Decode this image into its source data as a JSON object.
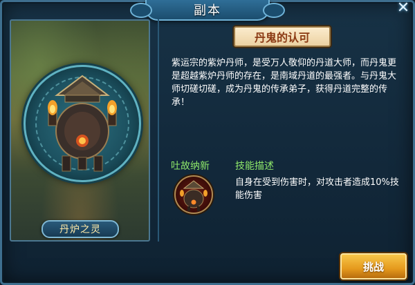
{
  "window": {
    "title": "副本"
  },
  "portrait": {
    "name": "丹炉之灵"
  },
  "info": {
    "skill_title": "丹鬼的认可",
    "description": "紫运宗的紫炉丹师，是受万人敬仰的丹道大师，而丹鬼更是超越紫炉丹师的存在，是南域丹道的最强者。与丹鬼大师切磋切磋，成为丹鬼的传承弟子，获得丹道完整的传承！",
    "skill_name_label": "吐故纳新",
    "skill_desc_label": "技能描述",
    "skill_desc": "自身在受到伤害时，对攻击者造成10%技能伤害"
  },
  "actions": {
    "challenge_label": "挑战"
  },
  "icons": {
    "close": "close-icon",
    "furnace": "alchemy-furnace-icon",
    "skill": "furnace-skill-icon"
  }
}
